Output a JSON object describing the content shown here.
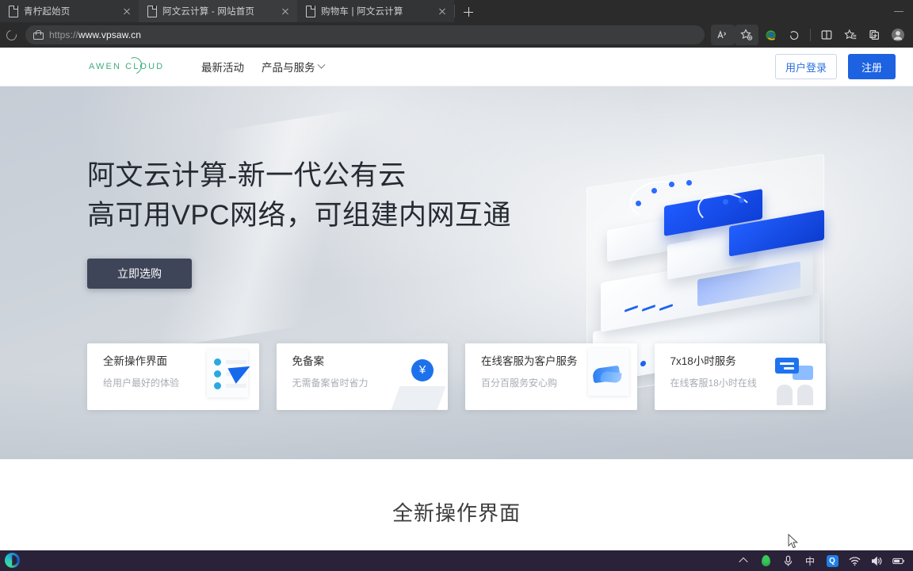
{
  "browser": {
    "tabs": [
      {
        "title": "青柠起始页",
        "icon": "page-icon",
        "active": false
      },
      {
        "title": "阿文云计算 - 网站首页",
        "icon": "page-icon",
        "active": true
      },
      {
        "title": "购物车 | 阿文云计算",
        "icon": "page-icon",
        "active": false
      }
    ],
    "new_tab_label": "+",
    "window_controls": {
      "minimize": "minimize-button"
    },
    "address": {
      "scheme": "https://",
      "host": "www.vpsaw.cn",
      "lock": "lock-icon"
    },
    "toolbar_icons": [
      "read-aloud-icon",
      "add-favorite-icon",
      "browser-essentials-icon",
      "copilot-icon",
      "split-screen-icon",
      "favorites-icon",
      "collections-icon",
      "profile-icon"
    ]
  },
  "site": {
    "logo": "AWEN CLOUD",
    "nav": [
      {
        "label": "最新活动",
        "has_caret": false
      },
      {
        "label": "产品与服务",
        "has_caret": true
      }
    ],
    "auth": {
      "login": "用户登录",
      "register": "注册"
    },
    "hero": {
      "heading_line1": "阿文云计算-新一代公有云",
      "heading_line2": "高可用VPC网络，可组建内网互通",
      "cta": "立即选购",
      "illustration": "cloud-server-3d-illustration"
    },
    "cards": [
      {
        "title": "全新操作界面",
        "subtitle": "给用户最好的体验",
        "icon": "checklist-pen-icon"
      },
      {
        "title": "免备案",
        "subtitle": "无需备案省时省力",
        "icon": "yen-coin-icon"
      },
      {
        "title": "在线客服为客户服务",
        "subtitle": "百分百服务安心购",
        "icon": "handshake-icon"
      },
      {
        "title": "7x18小时服务",
        "subtitle": "在线客服18小时在线",
        "icon": "chat-support-icon"
      }
    ],
    "section_title": "全新操作界面"
  },
  "taskbar": {
    "apps": [
      {
        "name": "edge-taskbar-icon"
      }
    ],
    "tray": [
      {
        "name": "show-hidden-icons-chevron",
        "label": ""
      },
      {
        "name": "green-drop-icon",
        "label": ""
      },
      {
        "name": "microphone-icon",
        "label": ""
      },
      {
        "name": "ime-language-icon",
        "label": "中"
      },
      {
        "name": "qq-icon",
        "label": "Q"
      },
      {
        "name": "wifi-icon",
        "label": ""
      },
      {
        "name": "speaker-icon",
        "label": ""
      },
      {
        "name": "battery-icon",
        "label": ""
      }
    ]
  },
  "colors": {
    "accent_blue": "#1d62e0",
    "logo_green": "#3fae7e",
    "cta_dark": "#3f4558",
    "taskbar": "#2a2238"
  }
}
